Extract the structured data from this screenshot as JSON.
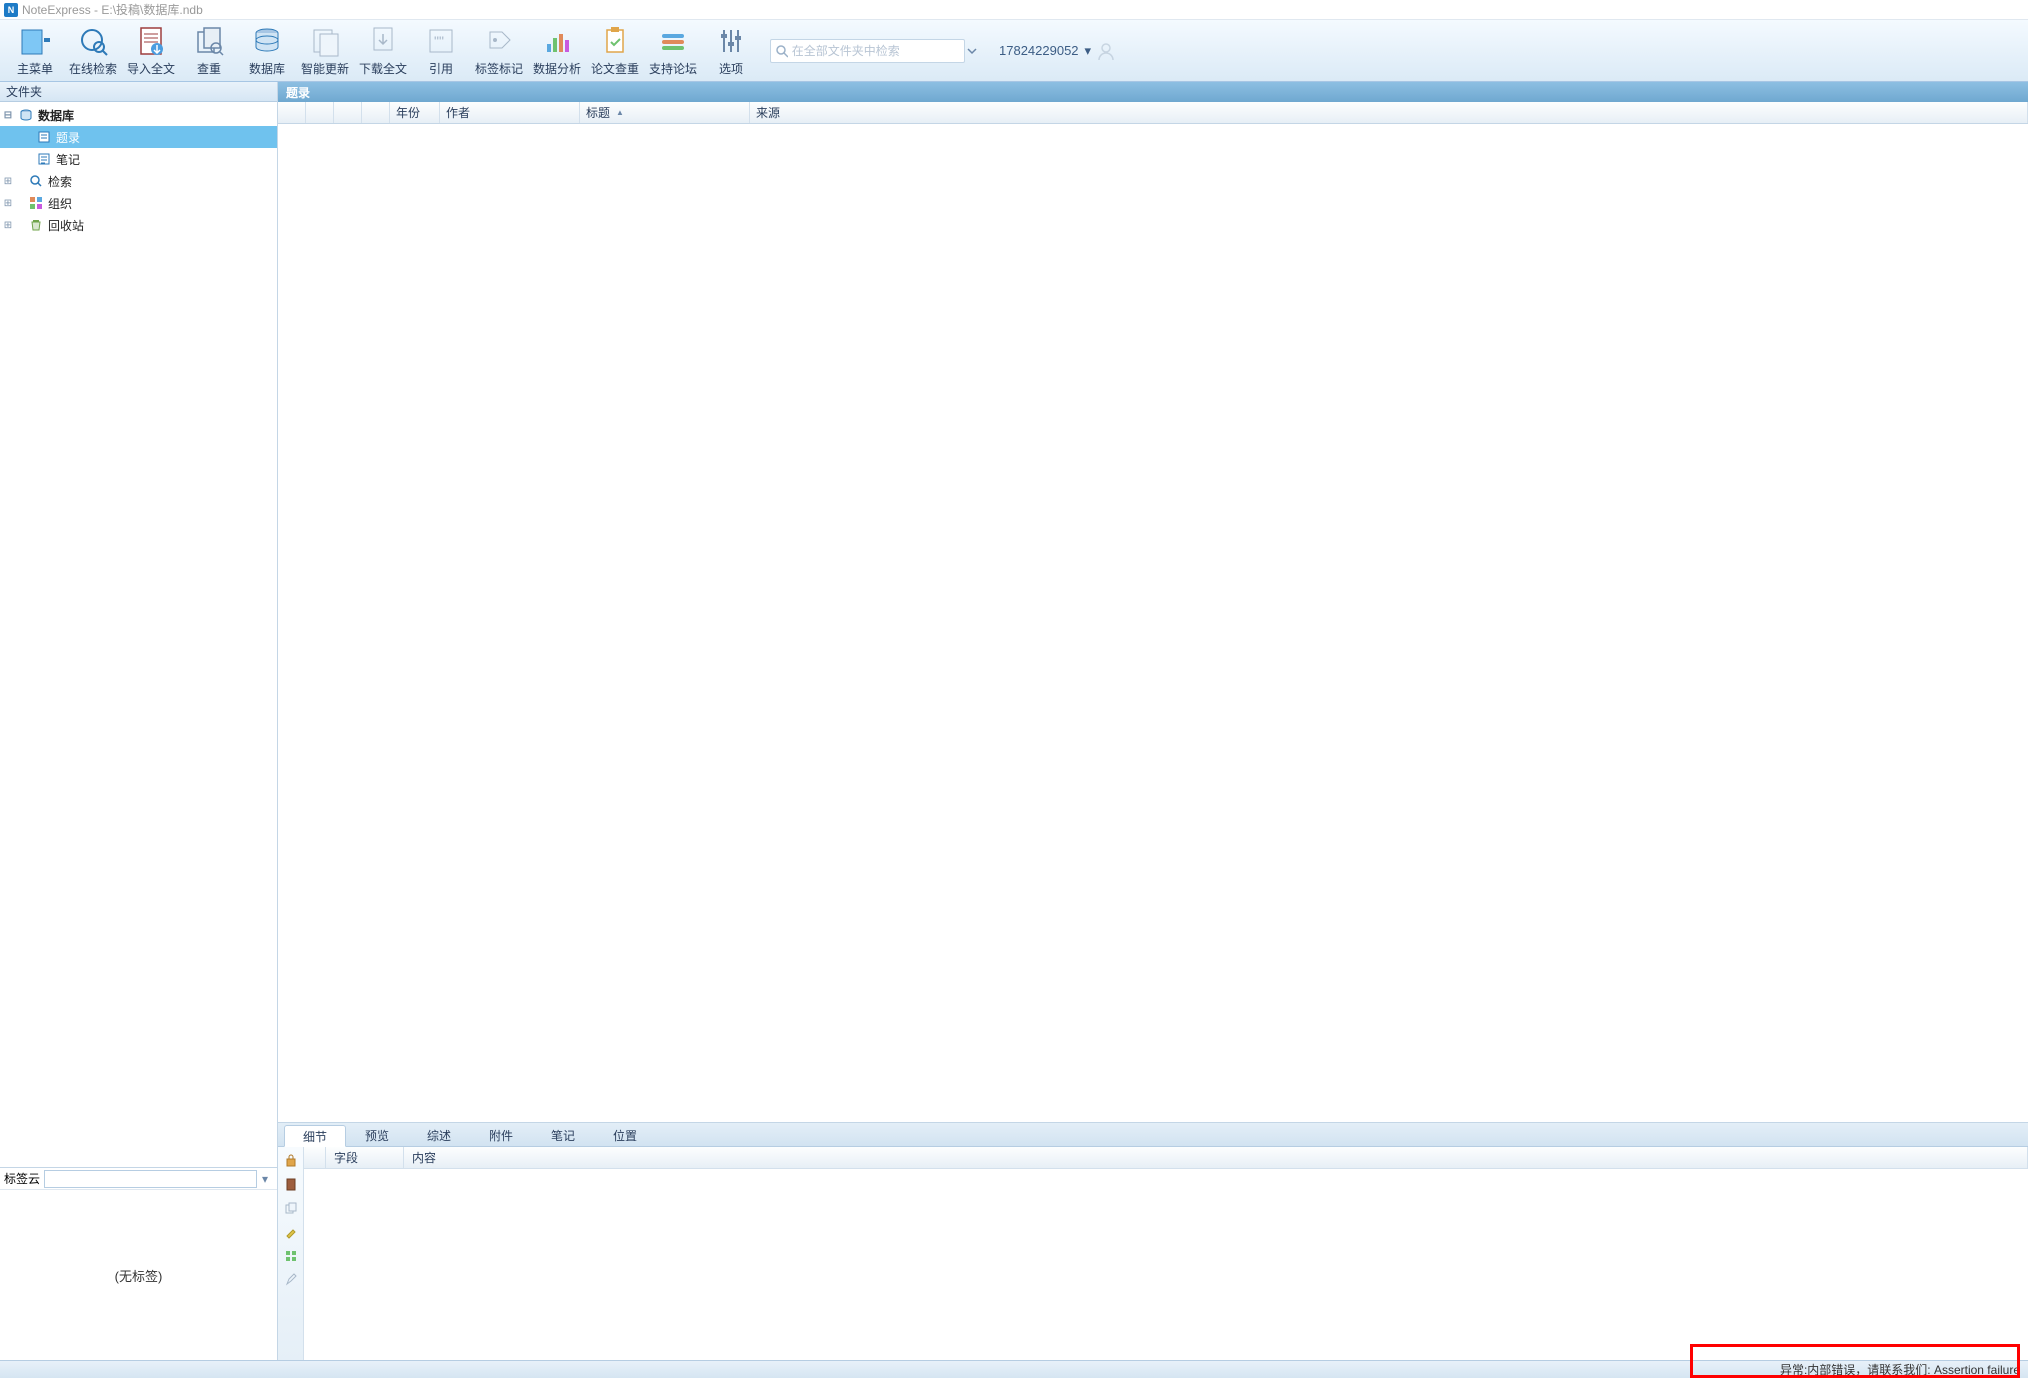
{
  "title_bar": {
    "app_name": "NoteExpress",
    "file_path": "E:\\投稿\\数据库.ndb"
  },
  "ribbon": {
    "buttons": [
      {
        "label": "主菜单"
      },
      {
        "label": "在线检索"
      },
      {
        "label": "导入全文"
      },
      {
        "label": "查重"
      },
      {
        "label": "数据库"
      },
      {
        "label": "智能更新"
      },
      {
        "label": "下载全文"
      },
      {
        "label": "引用"
      },
      {
        "label": "标签标记"
      },
      {
        "label": "数据分析"
      },
      {
        "label": "论文查重"
      },
      {
        "label": "支持论坛"
      },
      {
        "label": "选项"
      }
    ],
    "search_placeholder": "在全部文件夹中检索",
    "user_id": "17824229052"
  },
  "sidebar": {
    "header": "文件夹",
    "nodes": {
      "root": "数据库",
      "records": "题录",
      "notes": "笔记",
      "search": "检索",
      "organize": "组织",
      "recycle": "回收站"
    },
    "tagcloud": {
      "label": "标签云",
      "empty_text": "(无标签)"
    }
  },
  "records": {
    "header": "题录",
    "columns": {
      "year": "年份",
      "author": "作者",
      "title": "标题",
      "source": "来源"
    }
  },
  "detail": {
    "tabs": {
      "detail": "细节",
      "preview": "预览",
      "summary": "综述",
      "attachment": "附件",
      "note": "笔记",
      "location": "位置"
    },
    "columns": {
      "field": "字段",
      "content": "内容"
    }
  },
  "status": {
    "error_text": "异常:内部错误，请联系我们: Assertion failure"
  }
}
